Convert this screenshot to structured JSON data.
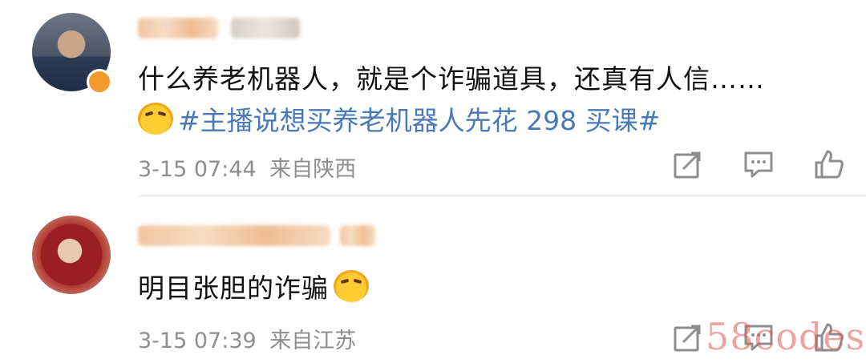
{
  "comments": [
    {
      "content": "什么养老机器人，就是个诈骗道具，还真有人信……",
      "topic": "#主播说想买养老机器人先花 298 买课#",
      "time": "3-15 07:44",
      "location": "来自陕西",
      "emoji_icon": "laughing-crying-emoji-icon"
    },
    {
      "content": "明目张胆的诈骗",
      "time": "3-15 07:39",
      "location": "来自江苏",
      "emoji_icon": "smirking-emoji-icon"
    }
  ],
  "watermark": "58codes"
}
